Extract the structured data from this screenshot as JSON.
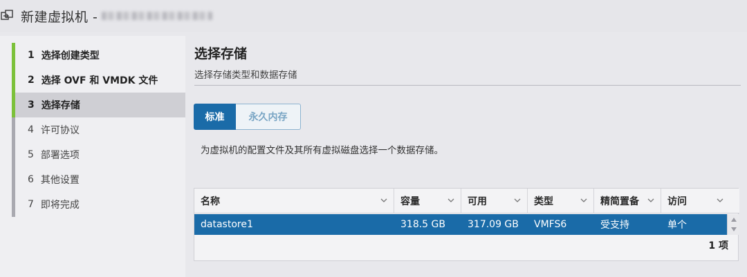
{
  "window": {
    "title": "新建虚拟机 -"
  },
  "steps": [
    {
      "num": "1",
      "label": "选择创建类型",
      "state": "done"
    },
    {
      "num": "2",
      "label": "选择 OVF 和 VMDK 文件",
      "state": "done"
    },
    {
      "num": "3",
      "label": "选择存储",
      "state": "current"
    },
    {
      "num": "4",
      "label": "许可协议",
      "state": "pending"
    },
    {
      "num": "5",
      "label": "部署选项",
      "state": "pending"
    },
    {
      "num": "6",
      "label": "其他设置",
      "state": "pending"
    },
    {
      "num": "7",
      "label": "即将完成",
      "state": "pending"
    }
  ],
  "page": {
    "title": "选择存储",
    "subtitle": "选择存储类型和数据存储"
  },
  "tabs": [
    {
      "label": "标准",
      "active": true
    },
    {
      "label": "永久内存",
      "active": false
    }
  ],
  "instruction": "为虚拟机的配置文件及其所有虚拟磁盘选择一个数据存储。",
  "table": {
    "columns": [
      "名称",
      "容量",
      "可用",
      "类型",
      "精简置备",
      "访问"
    ],
    "rows": [
      [
        "datastore1",
        "318.5 GB",
        "317.09 GB",
        "VMFS6",
        "受支持",
        "单个"
      ]
    ],
    "footer": "1 项"
  },
  "colors": {
    "accent": "#1a6ba8",
    "step_done": "#7cc13a"
  },
  "icons": [
    "vm-import-icon",
    "chevron-down-icon",
    "scroll-up-icon",
    "scroll-down-icon"
  ]
}
